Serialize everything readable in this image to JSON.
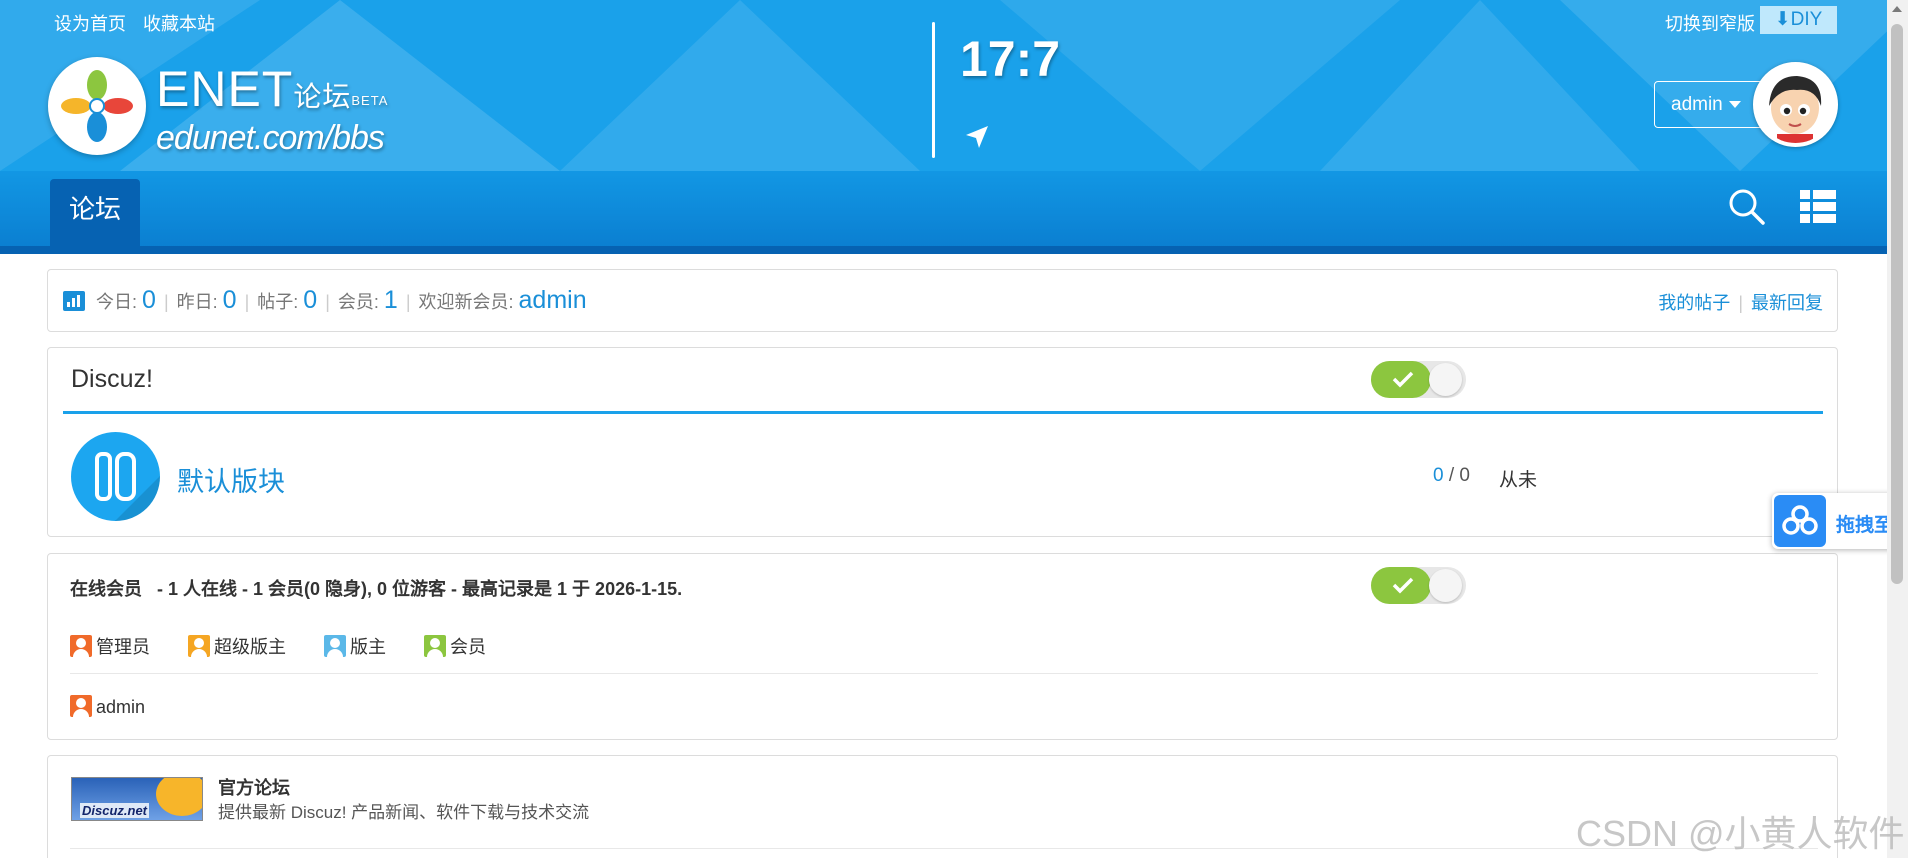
{
  "header": {
    "links": [
      "设为首页",
      "收藏本站"
    ],
    "brand_main": "ENET",
    "brand_cn": "论坛",
    "brand_tag": "BETA",
    "brand_sub": "edunet.com/bbs",
    "clock": "17:7",
    "narrow_label": "切换到窄版",
    "diy_label": "⬇DIY",
    "user_label": "admin"
  },
  "nav": {
    "tab_label": "论坛",
    "icons": [
      "search-icon",
      "grid-menu-icon"
    ]
  },
  "stats": {
    "today_label": "今日:",
    "today_value": "0",
    "yesterday_label": "昨日:",
    "yesterday_value": "0",
    "posts_label": "帖子:",
    "posts_value": "0",
    "members_label": "会员:",
    "members_value": "1",
    "welcome_label": "欢迎新会员:",
    "welcome_user": "admin",
    "separator": "|",
    "my_posts": "我的帖子",
    "latest_replies": "最新回复"
  },
  "forum": {
    "category_title": "Discuz!",
    "board_name": "默认版块",
    "threads": "0",
    "posts": "0",
    "count_separator": "/",
    "last_post": "从未"
  },
  "online": {
    "label": "在线会员",
    "summary": "- 1 人在线 - 1 会员(0 隐身), 0 位游客 - 最高记录是 1 于 2026-1-15.",
    "legend": [
      {
        "label": "管理员",
        "color": "#f06a2a"
      },
      {
        "label": "超级版主",
        "color": "#f5a623"
      },
      {
        "label": "版主",
        "color": "#5bb8e8"
      },
      {
        "label": "会员",
        "color": "#8cc63f"
      }
    ],
    "users": [
      {
        "name": "admin",
        "color": "#f06a2a"
      }
    ]
  },
  "links": {
    "banner_text": "Discuz.net",
    "name": "官方论坛",
    "description": "提供最新 Discuz! 产品新闻、软件下载与技术交流"
  },
  "float_widget": {
    "label": "拖拽至此"
  },
  "watermark": "CSDN @小黄人软件",
  "colors": {
    "header_bg": "#1aa1ea",
    "nav_dark": "#0662b2",
    "accent": "#1a8fd8",
    "toggle_on": "#8cc63f"
  }
}
